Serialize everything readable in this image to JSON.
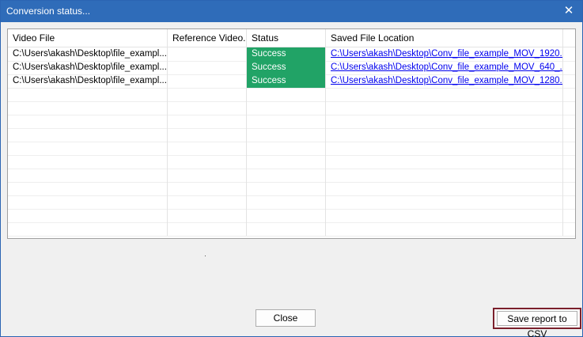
{
  "window": {
    "title": "Conversion status...",
    "close_glyph": "✕"
  },
  "table": {
    "columns": [
      "Video File",
      "Reference Video...",
      "Status",
      "Saved File Location",
      ""
    ],
    "rows": [
      {
        "video_file": "C:\\Users\\akash\\Desktop\\file_exampl...",
        "reference_video": "",
        "status": "Success",
        "saved_location": "C:\\Users\\akash\\Desktop\\Conv_file_example_MOV_1920..."
      },
      {
        "video_file": "C:\\Users\\akash\\Desktop\\file_exampl...",
        "reference_video": "",
        "status": "Success",
        "saved_location": "C:\\Users\\akash\\Desktop\\Conv_file_example_MOV_640_..."
      },
      {
        "video_file": "C:\\Users\\akash\\Desktop\\file_exampl...",
        "reference_video": "",
        "status": "Success",
        "saved_location": "C:\\Users\\akash\\Desktop\\Conv_file_example_MOV_1280..."
      }
    ],
    "status_color": "#21a366",
    "link_color": "#0000ee"
  },
  "buttons": {
    "close_label": "Close",
    "save_csv_label": "Save report to CSV"
  },
  "colors": {
    "titlebar": "#2f6cb9",
    "highlight_border": "#7a1f2b"
  }
}
